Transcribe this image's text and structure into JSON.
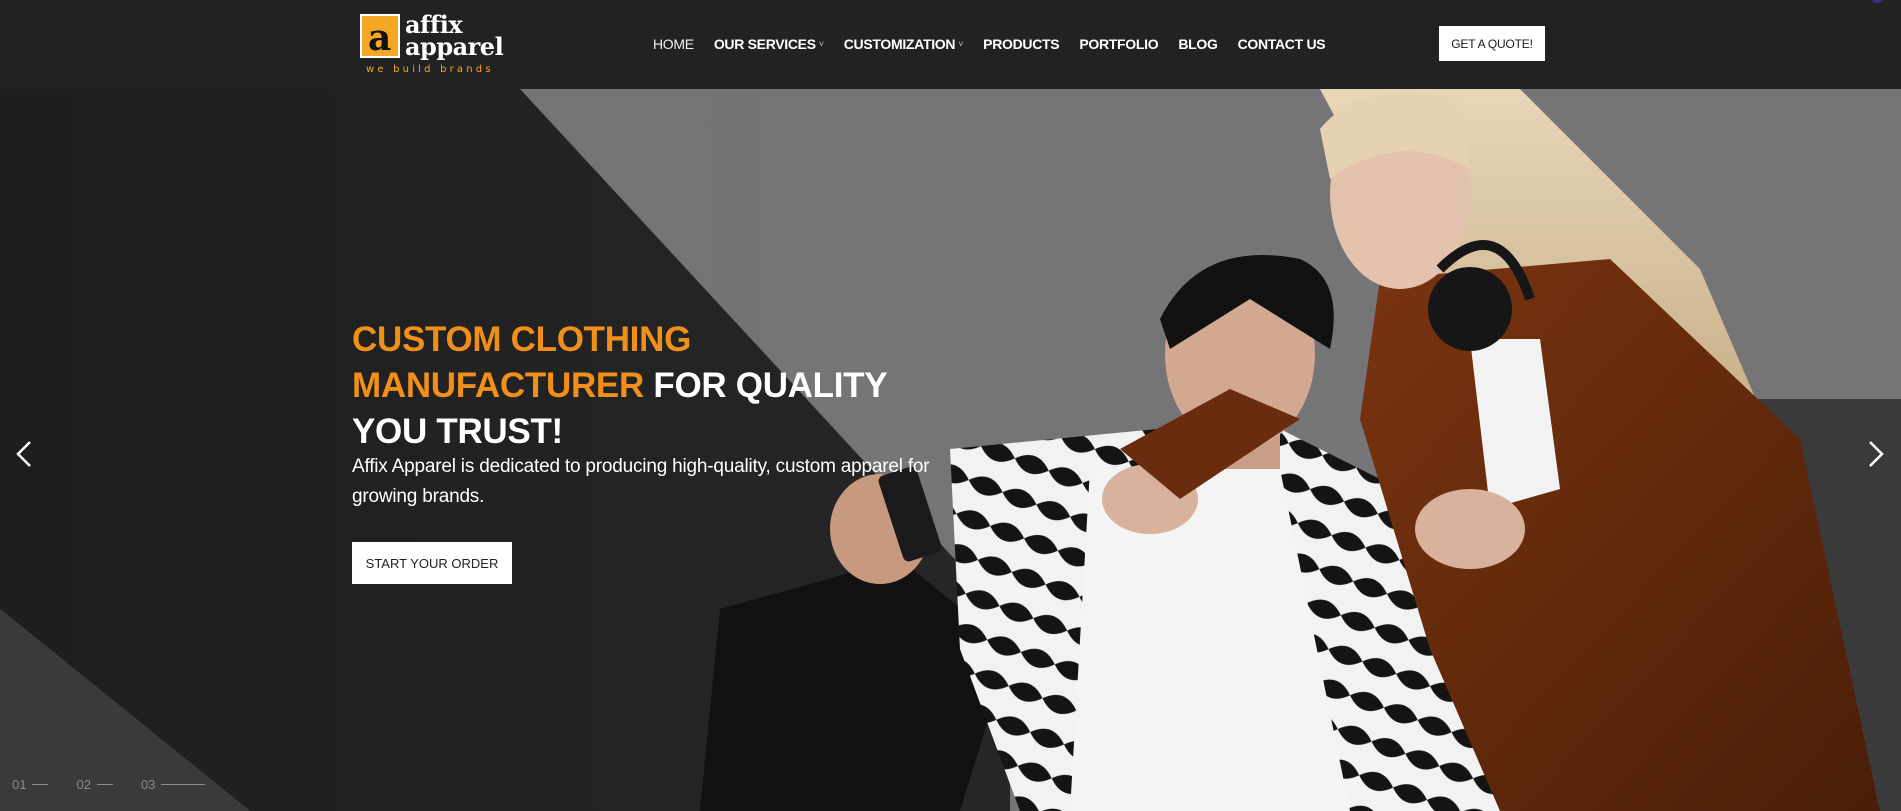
{
  "header": {
    "logo": {
      "mark_letter": "a",
      "word1": "affix",
      "word2": "apparel",
      "tagline": "we build brands"
    },
    "nav": {
      "items": [
        {
          "label": "HOME",
          "has_dropdown": false,
          "active": true
        },
        {
          "label": "OUR SERVICES",
          "has_dropdown": true
        },
        {
          "label": "CUSTOMIZATION",
          "has_dropdown": true
        },
        {
          "label": "PRODUCTS",
          "has_dropdown": false
        },
        {
          "label": "PORTFOLIO",
          "has_dropdown": false
        },
        {
          "label": "BLOG",
          "has_dropdown": false
        },
        {
          "label": "CONTACT US",
          "has_dropdown": false
        }
      ],
      "chevron_icon": "chevron-down-icon"
    },
    "quote_button": "GET A QUOTE!"
  },
  "hero": {
    "headline_orange": "CUSTOM CLOTHING MANUFACTURER",
    "headline_white": "FOR QUALITY YOU TRUST!",
    "description": "Affix Apparel is dedicated to producing high-quality, custom apparel for growing brands.",
    "cta_button": "START YOUR ORDER",
    "prev_icon": "chevron-left-icon",
    "next_icon": "chevron-right-icon",
    "slides": [
      {
        "num": "01",
        "active": false
      },
      {
        "num": "02",
        "active": false
      },
      {
        "num": "03",
        "active": true
      }
    ]
  },
  "colors": {
    "header_bg": "#222222",
    "accent_orange": "#f0901a",
    "logo_gold": "#f5a623",
    "button_bg": "#ffffff"
  }
}
